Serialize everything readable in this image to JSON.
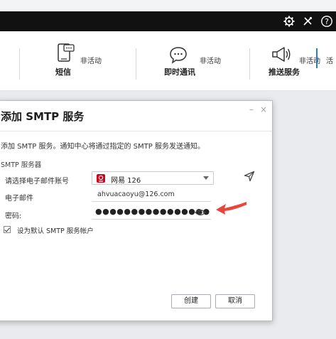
{
  "toolbar": {
    "icons": [
      "gear-icon",
      "tools-icon",
      "help-icon"
    ]
  },
  "channels": [
    {
      "label": "短信",
      "status": "非活动",
      "icon": "sms-icon"
    },
    {
      "label": "即时通讯",
      "status": "非活动",
      "icon": "chat-icon"
    },
    {
      "label": "推送服务",
      "status": "非活动",
      "icon": "megaphone-icon"
    },
    {
      "label": "",
      "status": "活",
      "icon": "partial-icon"
    }
  ],
  "dialog": {
    "title": "添加 SMTP 服务",
    "description": "添加 SMTP 服务。通知中心将通过指定的 SMTP 服务发送通知。",
    "section_title": "SMTP 服务器",
    "account_label": "请选择电子邮件账号",
    "account_value": "网易 126",
    "email_label": "电子邮件",
    "email_value": "ahvuacaoyu@126.com",
    "password_label": "密码:",
    "password_value": "●●●●●●●●●●●●●●●●",
    "default_label": "设为默认 SMTP 服务帐户",
    "default_checked": true,
    "create_label": "创建",
    "cancel_label": "取消"
  },
  "colors": {
    "topbar": "#111111",
    "accent_arrow": "#e8453c",
    "netease_red": "#d0021b"
  }
}
